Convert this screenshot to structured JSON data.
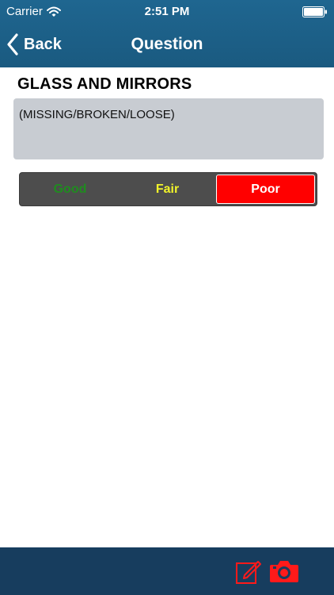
{
  "status_bar": {
    "carrier": "Carrier",
    "time": "2:51 PM"
  },
  "nav": {
    "back_label": "Back",
    "title": "Question"
  },
  "question": {
    "title": "GLASS AND MIRRORS",
    "description": "(MISSING/BROKEN/LOOSE)"
  },
  "rating": {
    "options": [
      "Good",
      "Fair",
      "Poor"
    ],
    "selected": "Poor"
  },
  "toolbar": {
    "icons": [
      "edit-note-icon",
      "camera-icon"
    ]
  },
  "colors": {
    "nav_bar": "#1f6690",
    "toolbar": "#173d5e",
    "good": "#1f8c1f",
    "fair": "#f1f32a",
    "poor_selected": "#ff0000",
    "segment_bg": "#4d4d4d",
    "description_bg": "#c8ccd2"
  }
}
